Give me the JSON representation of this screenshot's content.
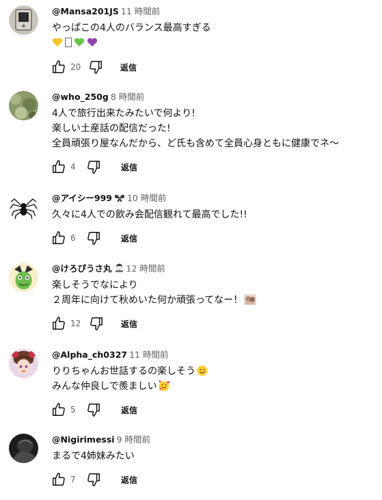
{
  "comments": [
    {
      "author": "@Mansa201JS",
      "time": "11 時間前",
      "lines": [
        "やっぱこの4人のバランス最高すぎる"
      ],
      "emoji_line": [
        "yellow-heart",
        "unknown-glyph",
        "green-heart",
        "purple-heart"
      ],
      "likes": "20",
      "reply_label": "返信"
    },
    {
      "author": "@who_250g",
      "time": "8 時間前",
      "lines": [
        "4人で旅行出来たみたいで何より!",
        "楽しい土産話の配信だった!",
        "全員頑張り屋なんだから、ど氏も含めて全員心身ともに健康でネ〜"
      ],
      "likes": "4",
      "reply_label": "返信"
    },
    {
      "author": "@アイシー999",
      "time": "10 時間前",
      "lines": [
        "久々に4人での飲み会配信観れて最高でした!!"
      ],
      "likes": "6",
      "reply_label": "返信"
    },
    {
      "author": "@けろぴうさ丸",
      "time": "12 時間前",
      "lines": [
        "楽しそうでなにより",
        "２周年に向けて秋めいた何か頑張ってなー！"
      ],
      "likes": "12",
      "reply_label": "返信"
    },
    {
      "author": "@Alpha_ch0327",
      "time": "11 時間前",
      "lines": [
        "りりちゃんお世話するの楽しそう",
        "みんな仲良しで羨ましい"
      ],
      "likes": "5",
      "reply_label": "返信"
    },
    {
      "author": "@Nigirimessi",
      "time": "9 時間前",
      "lines": [
        "まるで4姉妹みたい"
      ],
      "likes": "7",
      "reply_label": "返信"
    }
  ],
  "colors": {
    "text": "#0f0f0f",
    "meta": "#606060",
    "yellow_heart": "#f7c52b",
    "green_heart": "#6cc24a",
    "purple_heart": "#8e44ad"
  }
}
